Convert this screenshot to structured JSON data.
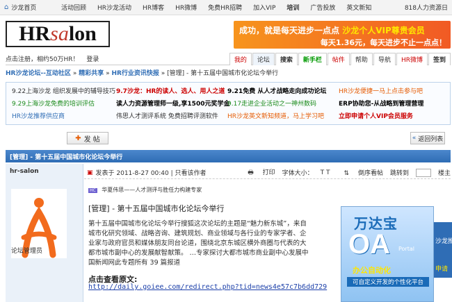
{
  "topnav": {
    "home": "沙龙首页",
    "links": [
      "活动回顾",
      "HR沙龙活动",
      "HR博客",
      "HR微博",
      "免费HR招聘",
      "加入VIP",
      "培训",
      "广告投放",
      "英文新知"
    ],
    "right": "818人力资源日"
  },
  "logo": {
    "part1": "HR",
    "part2": "sa",
    "part3": "lon"
  },
  "banner": {
    "line1a": "成功，就是每天进步一点点",
    "line1b": "沙龙个人VIP尊贵会员",
    "line2": "每天1.36元，每天进步不止一点点！"
  },
  "userbar": {
    "login": "点击注册，相约50万HR！",
    "signin": "登录",
    "tabs": [
      "我的",
      "论坛",
      "搜索",
      "新手栏",
      "帖件",
      "帮助",
      "导航",
      "HR微博",
      "签到"
    ]
  },
  "crumb": {
    "a": "HR沙龙论坛--互动社区",
    "b": "精彩共享",
    "c": "HR行业资讯快报",
    "d": "[管理] - 第十五届中国城市化论坛今举行"
  },
  "promo": {
    "r1": [
      "9.22上海沙龙 组织发展中的辅导技巧",
      "9.7沙龙：HR的读人、选人、用人之道",
      "9.21免费 从人才战略走向成功论坛",
      "HR沙龙便捷一马上点击参与吧"
    ],
    "r2": [
      "9.29上海沙龙免费的培训评估",
      "读人力资源管理师一级,享1500元奖学金",
      "9.17走进企业活动之一神州数码",
      "ERP协助您-从战略到管理营理"
    ],
    "r3": [
      "HR沙龙推荐供应商",
      "伟思人才测评系统 免费招聘评测软件",
      "HR沙龙英文新知频道，马上学习吧",
      "立即申请个人VIP会员服务"
    ]
  },
  "toolbar": {
    "post": "发 帖",
    "back": "返回列表"
  },
  "thread": {
    "title": "[管理] - 第十五届中国城市化论坛今举行"
  },
  "author": {
    "name": "hr-salon",
    "role": "论坛管理员"
  },
  "meta": {
    "time": "发表于 2011-8-27 00:40",
    "author_only": "只看该作者",
    "print": "打印",
    "font": "字体大小：",
    "order": "倒序看帖",
    "jump": "跳转到",
    "floor": "楼主"
  },
  "post": {
    "sig_tag": "HC",
    "sig": "华夏伟思——人才测评与胜任力构建专家",
    "title": "[管理] - 第十五届中国城市化论坛今举行",
    "body": "第十五届中国城市化论坛今举行搜狐这次论坛的主题是“魅力新东城”，来自城市化研究领域、战略咨询、建筑规划、商业领域与各行业的专家学者、企业家与政府官员和媒体朋友同台论道，围绕北京东城区横外商圈与代表的大都市城市副中心的发展献智献策。 …专家探讨大都市城市商业副中心发展中国新闻网此专题所有 39 篇报道",
    "src": "点击查看原文:",
    "link": "http://daily.goiee.com/redirect.php?tid=news4e57c7b6dd729"
  },
  "ad": {
    "t1": "万达宝",
    "t2": "OA",
    "t3": "Portal",
    "t4": "办公自动化",
    "t5": "可自定义开发的个性化平台"
  },
  "strip": {
    "s1": "沙龙推",
    "s2": "申请"
  }
}
